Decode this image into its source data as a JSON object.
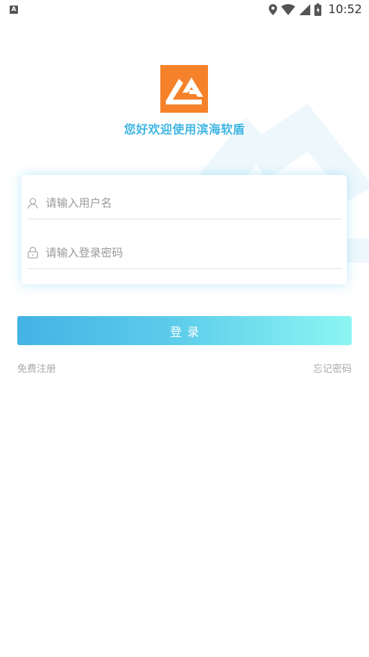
{
  "status_bar": {
    "notification_icon": "a-notification-icon",
    "time": "10:52"
  },
  "branding": {
    "logo_icon": "app-logo-icon",
    "logo_color": "#f5822a",
    "welcome_text": "您好欢迎使用滨海软盾"
  },
  "form": {
    "username": {
      "placeholder": "请输入用户名",
      "value": "",
      "icon": "user-icon"
    },
    "password": {
      "placeholder": "请输入登录密码",
      "value": "",
      "icon": "lock-icon"
    }
  },
  "actions": {
    "login_label": "登录",
    "register_label": "免费注册",
    "forgot_label": "忘记密码"
  },
  "colors": {
    "accent": "#3fb6e3",
    "button_gradient_start": "#43b3e6",
    "button_gradient_end": "#8cf6f3"
  }
}
